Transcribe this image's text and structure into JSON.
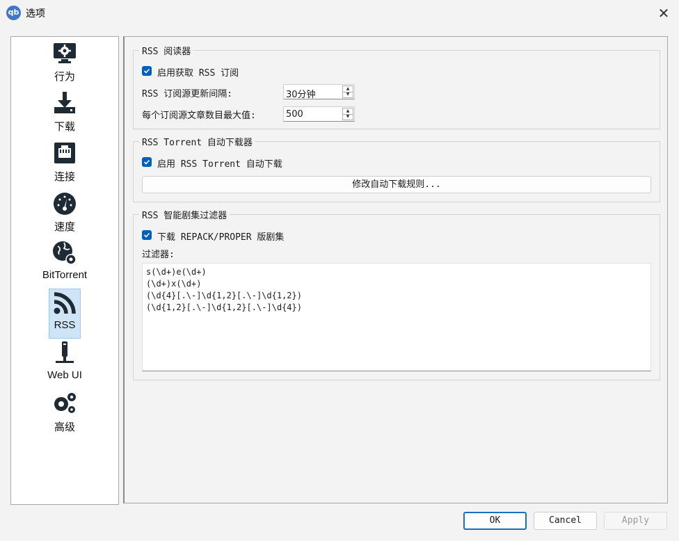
{
  "window": {
    "app_icon_text": "qb",
    "title": "选项",
    "close_glyph": "✕"
  },
  "sidebar": {
    "selected": "RSS",
    "items": [
      {
        "label": "行为",
        "icon": "monitor-gear-icon"
      },
      {
        "label": "下载",
        "icon": "download-icon"
      },
      {
        "label": "连接",
        "icon": "network-port-icon"
      },
      {
        "label": "速度",
        "icon": "speedometer-icon"
      },
      {
        "label": "BitTorrent",
        "icon": "globe-gear-icon"
      },
      {
        "label": "RSS",
        "icon": "rss-icon"
      },
      {
        "label": "Web UI",
        "icon": "web-ui-icon"
      },
      {
        "label": "高级",
        "icon": "gears-icon"
      }
    ]
  },
  "rss_reader": {
    "title": "RSS 阅读器",
    "enable_fetch_label": "启用获取 RSS 订阅",
    "enable_fetch_checked": true,
    "refresh_interval_label": "RSS 订阅源更新间隔:",
    "refresh_interval_value": "30分钟",
    "max_articles_label": "每个订阅源文章数目最大值:",
    "max_articles_value": "500"
  },
  "rss_downloader": {
    "title": "RSS Torrent 自动下载器",
    "enable_label": "启用 RSS Torrent 自动下载",
    "enable_checked": true,
    "edit_rules_label": "修改自动下载规则..."
  },
  "smart_filter": {
    "title": "RSS 智能剧集过滤器",
    "download_repack_label": "下载 REPACK/PROPER 版剧集",
    "download_repack_checked": true,
    "filters_label": "过滤器:",
    "filters_text": "s(\\d+)e(\\d+)\n(\\d+)x(\\d+)\n(\\d{4}[.\\-]\\d{1,2}[.\\-]\\d{1,2})\n(\\d{1,2}[.\\-]\\d{1,2}[.\\-]\\d{4})"
  },
  "buttons": {
    "ok": "OK",
    "cancel": "Cancel",
    "apply": "Apply",
    "apply_enabled": false
  },
  "colors": {
    "accent": "#005fb8",
    "selection": "#cfe4f7",
    "icon": "#1e2a34"
  }
}
